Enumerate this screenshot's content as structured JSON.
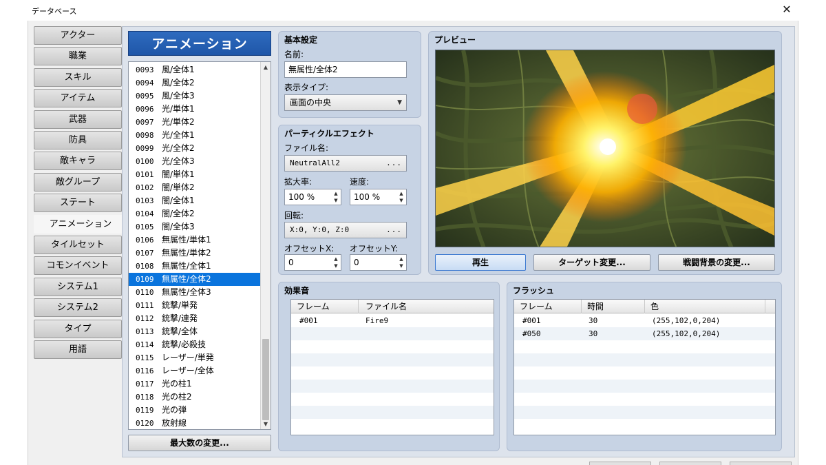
{
  "window": {
    "title": "データベース",
    "close_glyph": "✕"
  },
  "categories": [
    "アクター",
    "職業",
    "スキル",
    "アイテム",
    "武器",
    "防具",
    "敵キャラ",
    "敵グループ",
    "ステート",
    "アニメーション",
    "タイルセット",
    "コモンイベント",
    "システム1",
    "システム2",
    "タイプ",
    "用語"
  ],
  "active_category": "アニメーション",
  "list": {
    "header": "アニメーション",
    "items": [
      {
        "num": "0093",
        "name": "風/全体1"
      },
      {
        "num": "0094",
        "name": "風/全体2"
      },
      {
        "num": "0095",
        "name": "風/全体3"
      },
      {
        "num": "0096",
        "name": "光/単体1"
      },
      {
        "num": "0097",
        "name": "光/単体2"
      },
      {
        "num": "0098",
        "name": "光/全体1"
      },
      {
        "num": "0099",
        "name": "光/全体2"
      },
      {
        "num": "0100",
        "name": "光/全体3"
      },
      {
        "num": "0101",
        "name": "闇/単体1"
      },
      {
        "num": "0102",
        "name": "闇/単体2"
      },
      {
        "num": "0103",
        "name": "闇/全体1"
      },
      {
        "num": "0104",
        "name": "闇/全体2"
      },
      {
        "num": "0105",
        "name": "闇/全体3"
      },
      {
        "num": "0106",
        "name": "無属性/単体1"
      },
      {
        "num": "0107",
        "name": "無属性/単体2"
      },
      {
        "num": "0108",
        "name": "無属性/全体1"
      },
      {
        "num": "0109",
        "name": "無属性/全体2"
      },
      {
        "num": "0110",
        "name": "無属性/全体3"
      },
      {
        "num": "0111",
        "name": "銃撃/単発"
      },
      {
        "num": "0112",
        "name": "銃撃/連発"
      },
      {
        "num": "0113",
        "name": "銃撃/全体"
      },
      {
        "num": "0114",
        "name": "銃撃/必殺技"
      },
      {
        "num": "0115",
        "name": "レーザー/単発"
      },
      {
        "num": "0116",
        "name": "レーザー/全体"
      },
      {
        "num": "0117",
        "name": "光の柱1"
      },
      {
        "num": "0118",
        "name": "光の柱2"
      },
      {
        "num": "0119",
        "name": "光の弾"
      },
      {
        "num": "0120",
        "name": "放射線"
      }
    ],
    "selected_num": "0109",
    "max_button": "最大数の変更..."
  },
  "basic": {
    "title": "基本設定",
    "name_label": "名前:",
    "name_value": "無属性/全体2",
    "display_type_label": "表示タイプ:",
    "display_type_value": "画面の中央"
  },
  "particle": {
    "title": "パーティクルエフェクト",
    "file_label": "ファイル名:",
    "file_value": "NeutralAll2",
    "scale_label": "拡大率:",
    "scale_value": "100 %",
    "speed_label": "速度:",
    "speed_value": "100 %",
    "rotation_label": "回転:",
    "rotation_value": "X:0, Y:0, Z:0",
    "offset_x_label": "オフセットX:",
    "offset_x_value": "0",
    "offset_y_label": "オフセットY:",
    "offset_y_value": "0",
    "ellipsis": "..."
  },
  "preview": {
    "title": "プレビュー",
    "play_button": "再生",
    "target_button": "ターゲット変更...",
    "background_button": "戦闘背景の変更..."
  },
  "sound": {
    "title": "効果音",
    "columns": [
      "フレーム",
      "ファイル名"
    ],
    "rows": [
      {
        "frame": "#001",
        "file": "Fire9"
      }
    ]
  },
  "flash": {
    "title": "フラッシュ",
    "columns": [
      "フレーム",
      "時間",
      "色"
    ],
    "rows": [
      {
        "frame": "#001",
        "duration": "30",
        "color": "(255,102,0,204)"
      },
      {
        "frame": "#050",
        "duration": "30",
        "color": "(255,102,0,204)"
      }
    ]
  },
  "colors": {
    "selection": "#0a74dd",
    "header_blue": "#1f56a8",
    "panel_bg": "#c7d3e4",
    "flash_color": "#ff6600"
  }
}
